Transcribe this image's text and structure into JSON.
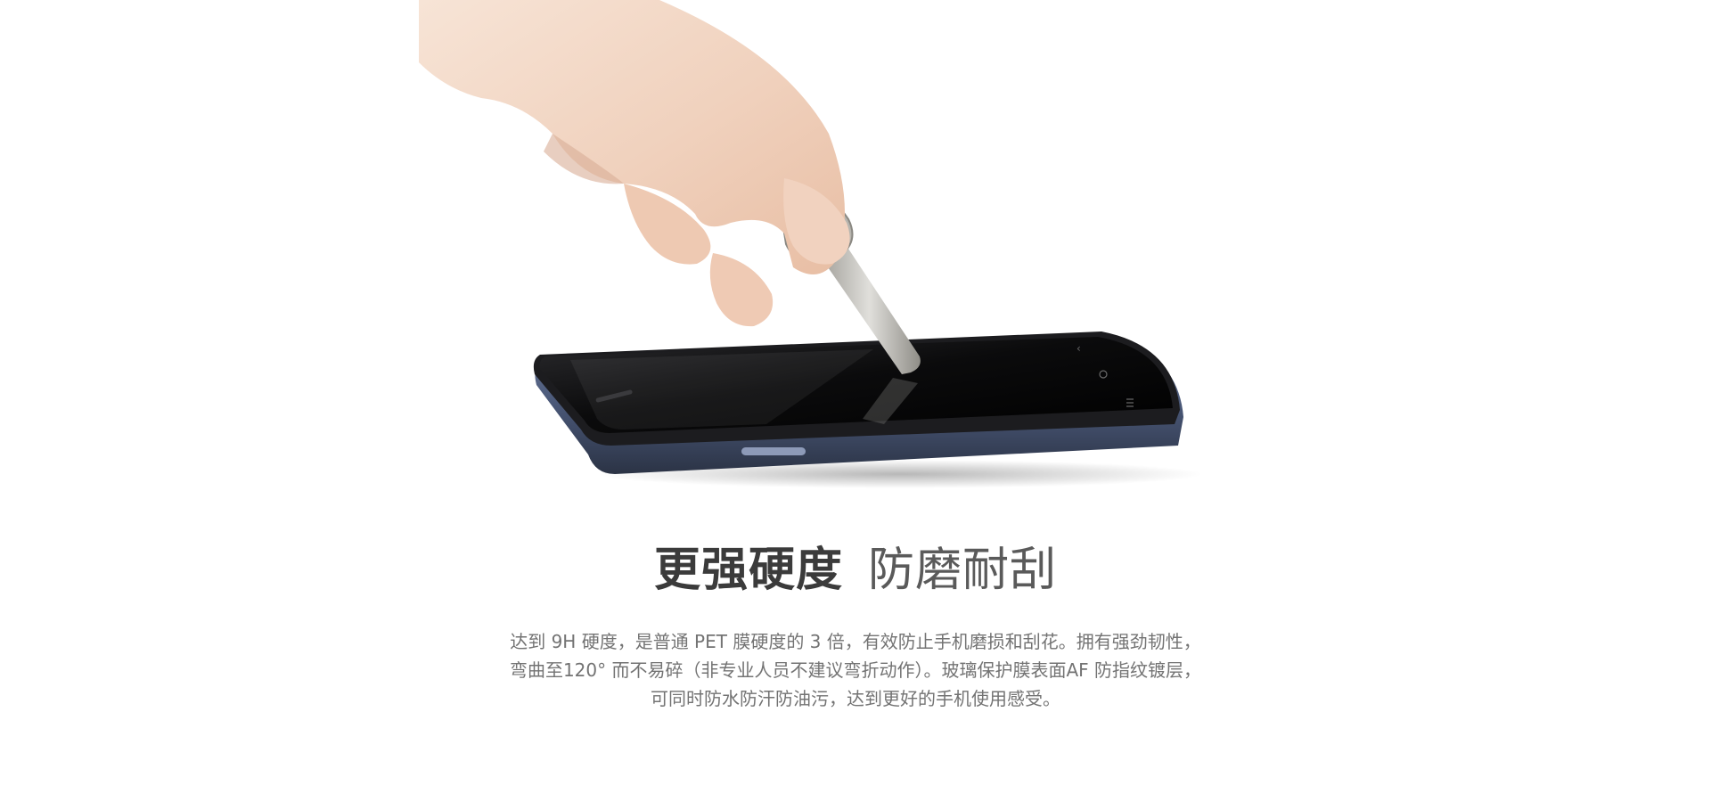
{
  "hero": {
    "scene": "hand-holding-key-scratching-phone",
    "colors": {
      "skin": "#f3d6bf",
      "phone_body": "#4a5878",
      "screen": "#0b0b0c",
      "key_metal": "#c8c7c2"
    }
  },
  "headline": {
    "strong": "更强硬度",
    "light": "防磨耐刮"
  },
  "description": {
    "lines": [
      "达到 9H 硬度，是普通 PET 膜硬度的 3 倍，有效防止手机磨损和刮花。拥有强劲韧性，",
      "弯曲至120°  而不易碎（非专业人员不建议弯折动作）。玻璃保护膜表面AF 防指纹镀层，",
      "可同时防水防汗防油污，达到更好的手机使用感受。"
    ]
  }
}
